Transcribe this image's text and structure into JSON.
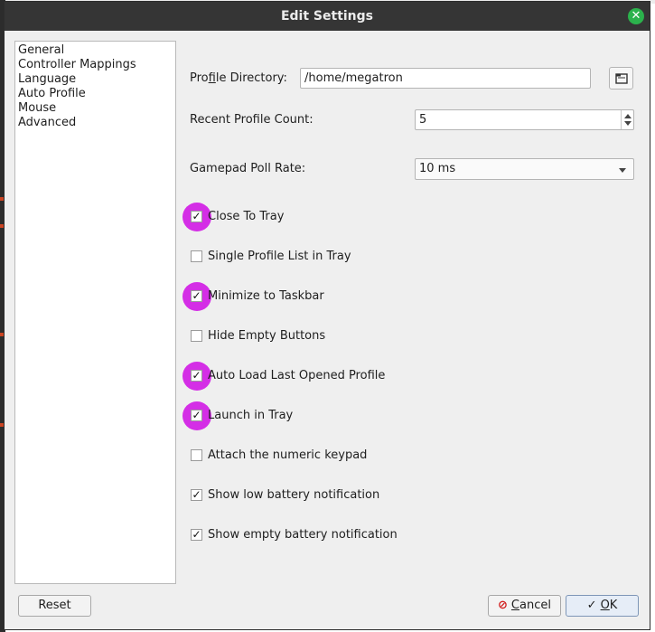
{
  "dialog": {
    "title": "Edit Settings",
    "close_icon": "close-icon",
    "accent_close_color": "#2bb24c",
    "highlight_color": "#d42ee6"
  },
  "nav": {
    "items": [
      {
        "label": "General"
      },
      {
        "label": "Controller Mappings"
      },
      {
        "label": "Language"
      },
      {
        "label": "Auto Profile"
      },
      {
        "label": "Mouse"
      },
      {
        "label": "Advanced"
      }
    ]
  },
  "general": {
    "profile_directory": {
      "label_pre": "Pro",
      "label_mnemonic": "f",
      "label_post": "ile Directory:",
      "value": "/home/megatron",
      "browse_icon": "folder-icon"
    },
    "recent_profile_count": {
      "label": "Recent Profile Count:",
      "value": "5"
    },
    "gamepad_poll_rate": {
      "label": "Gamepad Poll Rate:",
      "value": "10 ms"
    },
    "checkboxes": [
      {
        "label": "Close To Tray",
        "checked": true,
        "highlighted": true
      },
      {
        "label": "Single Profile List in Tray",
        "checked": false,
        "highlighted": false
      },
      {
        "label": "Minimize to Taskbar",
        "checked": true,
        "highlighted": true
      },
      {
        "label": "Hide Empty Buttons",
        "checked": false,
        "highlighted": false
      },
      {
        "label": "Auto Load Last Opened Profile",
        "checked": true,
        "highlighted": true
      },
      {
        "label": "Launch in Tray",
        "checked": true,
        "highlighted": true
      },
      {
        "label": "Attach the numeric keypad",
        "checked": false,
        "highlighted": false
      },
      {
        "label": "Show low battery notification",
        "checked": true,
        "highlighted": false
      },
      {
        "label": "Show empty battery notification",
        "checked": true,
        "highlighted": false
      }
    ]
  },
  "footer": {
    "reset_label": "Reset",
    "cancel_mnemonic": "C",
    "cancel_rest": "ancel",
    "cancel_icon": "cancel-icon",
    "ok_mnemonic": "O",
    "ok_rest": "K",
    "ok_icon": "check-icon"
  }
}
